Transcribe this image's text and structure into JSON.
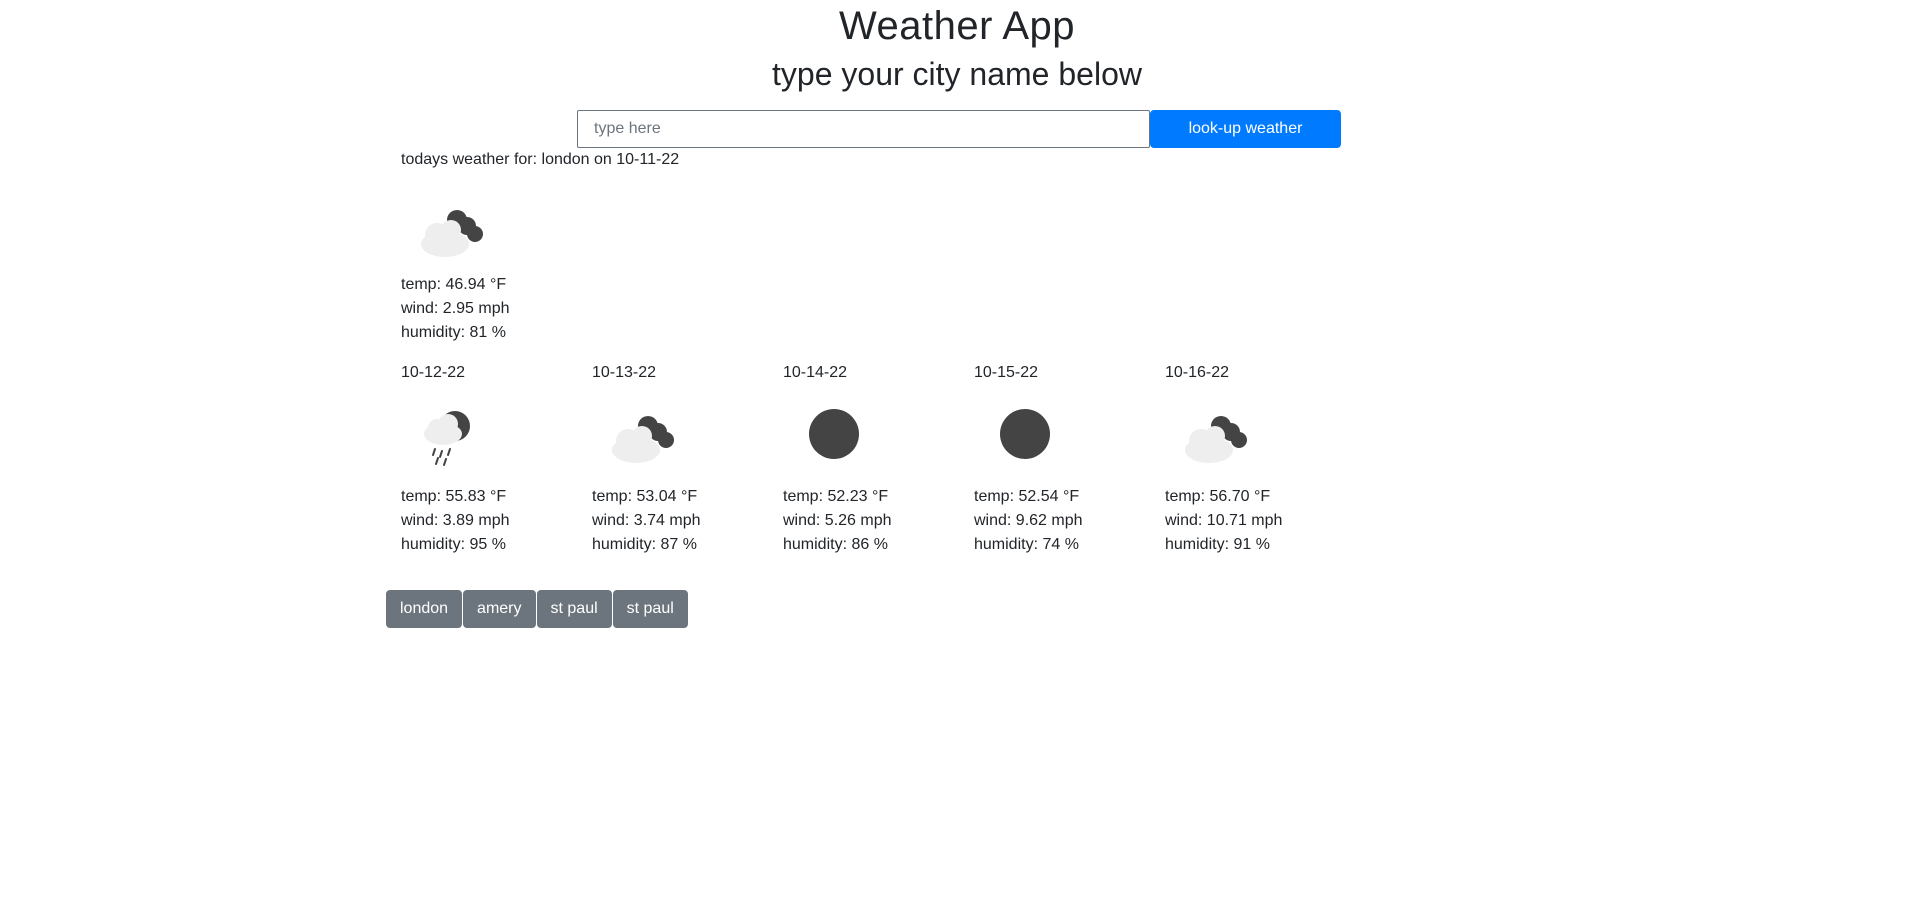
{
  "header": {
    "title": "Weather App",
    "subtitle": "type your city name below"
  },
  "search": {
    "placeholder": "type here",
    "value": "",
    "button_label": "look-up weather"
  },
  "today": {
    "label": "todays weather for: london on 10-11-22",
    "icon": "partly-cloudy-night-icon",
    "temp": "temp: 46.94 °F",
    "wind": "wind: 2.95 mph",
    "humidity": "humidity: 81 %"
  },
  "forecast": [
    {
      "date": "10-12-22",
      "icon": "rain-night-icon",
      "temp": "temp: 55.83 °F",
      "wind": "wind: 3.89 mph",
      "humidity": "humidity: 95 %"
    },
    {
      "date": "10-13-22",
      "icon": "partly-cloudy-night-icon",
      "temp": "temp: 53.04 °F",
      "wind": "wind: 3.74 mph",
      "humidity": "humidity: 87 %"
    },
    {
      "date": "10-14-22",
      "icon": "clear-night-icon",
      "temp": "temp: 52.23 °F",
      "wind": "wind: 5.26 mph",
      "humidity": "humidity: 86 %"
    },
    {
      "date": "10-15-22",
      "icon": "clear-night-icon",
      "temp": "temp: 52.54 °F",
      "wind": "wind: 9.62 mph",
      "humidity": "humidity: 74 %"
    },
    {
      "date": "10-16-22",
      "icon": "partly-cloudy-night-icon",
      "temp": "temp: 56.70 °F",
      "wind": "wind: 10.71 mph",
      "humidity": "humidity: 91 %"
    }
  ],
  "history": {
    "cities": [
      "london",
      "amery",
      "st paul",
      "st paul"
    ]
  },
  "colors": {
    "primary": "#007bff",
    "secondary": "#6c757d",
    "moon": "#444444",
    "cloud": "#eeeeee",
    "text": "#212529"
  }
}
